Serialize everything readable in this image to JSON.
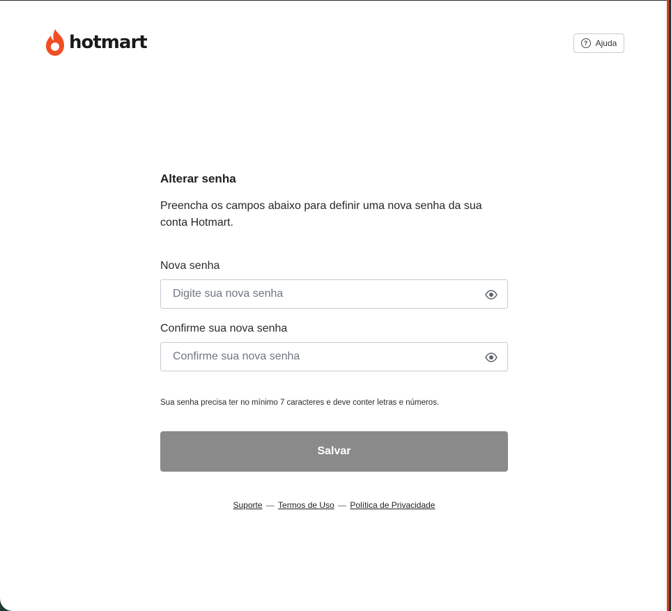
{
  "header": {
    "logo_text": "hotmart",
    "help_label": "Ajuda"
  },
  "form": {
    "title": "Alterar senha",
    "description": "Preencha os campos abaixo para definir uma nova senha da sua conta Hotmart.",
    "new_password": {
      "label": "Nova senha",
      "placeholder": "Digite sua nova senha",
      "value": ""
    },
    "confirm_password": {
      "label": "Confirme sua nova senha",
      "placeholder": "Confirme sua nova senha",
      "value": ""
    },
    "hint": "Sua senha precisa ter no mínimo 7 caracteres e deve conter letras e números.",
    "save_label": "Salvar"
  },
  "footer": {
    "links": [
      "Suporte",
      "Termos de Uso",
      "Política de Privacidade"
    ],
    "separator": "—"
  },
  "colors": {
    "brand": "#f04e23",
    "button_disabled": "#8a8a8a",
    "window_border": "#d6402b"
  },
  "icons": {
    "logo": "flame-icon",
    "help": "question-circle-icon",
    "toggle_visibility": "eye-icon"
  }
}
